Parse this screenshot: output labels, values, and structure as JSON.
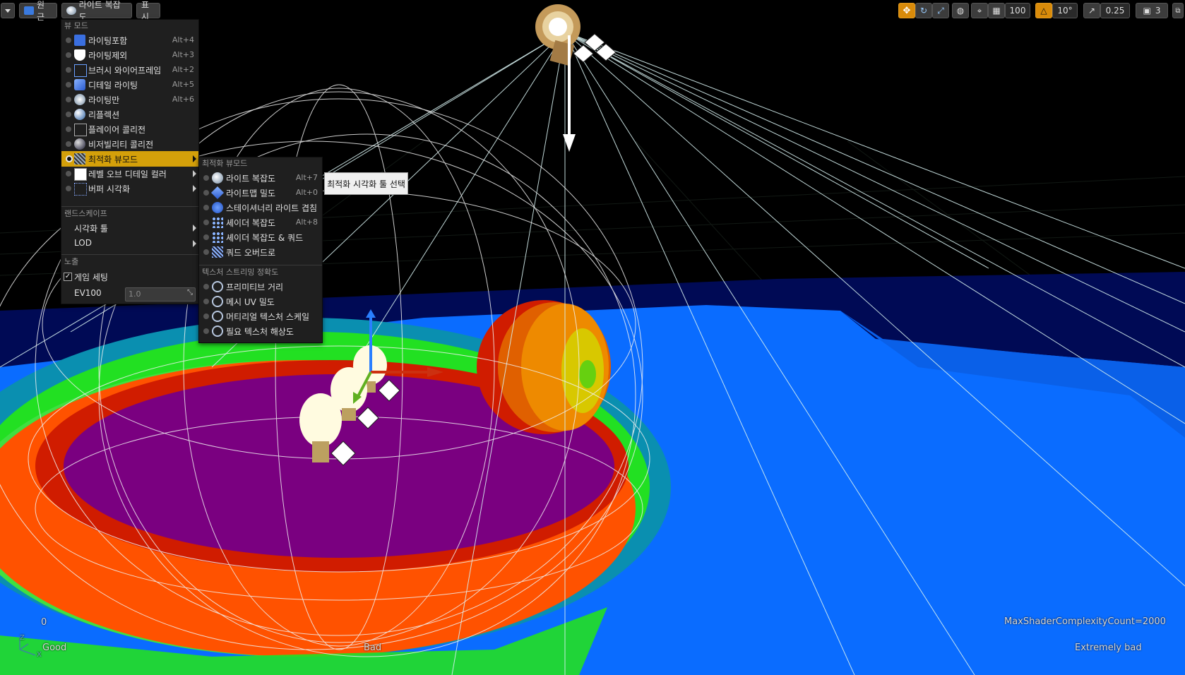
{
  "toolbar": {
    "dropdown_label": "",
    "perspective_label": "원근",
    "viewmode_label": "라이트 복잡도",
    "show_label": "표시"
  },
  "right_toolbar": {
    "grid_snap_value": "100",
    "rotation_snap_value": "10°",
    "scale_snap_value": "0.25",
    "camera_speed_value": "3"
  },
  "view_mode_menu": {
    "section_view_mode": "뷰 모드",
    "items": [
      {
        "label": "라이팅포함",
        "shortcut": "Alt+4",
        "icon": "lit-cube-icon"
      },
      {
        "label": "라이팅제외",
        "shortcut": "Alt+3",
        "icon": "unlit-shield-icon"
      },
      {
        "label": "브러시 와이어프레임",
        "shortcut": "Alt+2",
        "icon": "wireframe-cube-icon"
      },
      {
        "label": "디테일 라이팅",
        "shortcut": "Alt+5",
        "icon": "detail-lighting-icon"
      },
      {
        "label": "라이팅만",
        "shortcut": "Alt+6",
        "icon": "lighting-only-icon"
      },
      {
        "label": "리플렉션",
        "shortcut": "",
        "icon": "reflection-sphere-icon"
      },
      {
        "label": "플레이어 콜리전",
        "shortcut": "",
        "icon": "player-collision-icon"
      },
      {
        "label": "비저빌리티 콜리전",
        "shortcut": "",
        "icon": "visibility-collision-icon"
      },
      {
        "label": "최적화 뷰모드",
        "shortcut": "",
        "icon": "optimization-grid-icon",
        "selected": true,
        "submenu": true
      },
      {
        "label": "레벨 오브 디테일 컬러",
        "shortcut": "",
        "icon": "lod-color-icon",
        "submenu": true
      },
      {
        "label": "버퍼 시각화",
        "shortcut": "",
        "icon": "buffer-visualization-icon",
        "submenu": true
      }
    ],
    "section_landscape": "랜드스케이프",
    "landscape_items": [
      {
        "label": "시각화 툴"
      },
      {
        "label": "LOD"
      }
    ],
    "section_exposure": "노출",
    "game_settings_label": "게임 세팅",
    "game_settings_checked": true,
    "ev100_label": "EV100",
    "ev100_value": "1.0"
  },
  "optimization_submenu": {
    "section_optimization": "최적화 뷰모드",
    "items": [
      {
        "label": "라이트 복잡도",
        "shortcut": "Alt+7",
        "icon": "light-complexity-icon"
      },
      {
        "label": "라이트맵 밀도",
        "shortcut": "Alt+0",
        "icon": "lightmap-density-icon"
      },
      {
        "label": "스테이셔너리 라이트 겹침",
        "shortcut": "",
        "icon": "stationary-light-overlap-icon"
      },
      {
        "label": "셰이더 복잡도",
        "shortcut": "Alt+8",
        "icon": "shader-complexity-icon"
      },
      {
        "label": "셰이더 복잡도 & 쿼드",
        "shortcut": "",
        "icon": "shader-quad-icon"
      },
      {
        "label": "쿼드 오버드로",
        "shortcut": "",
        "icon": "quad-overdraw-icon"
      }
    ],
    "section_texture": "텍스처 스트리밍 정확도",
    "texture_items": [
      {
        "label": "프리미티브 거리",
        "icon": "crosshair-icon"
      },
      {
        "label": "메시 UV 밀도",
        "icon": "crosshair-icon"
      },
      {
        "label": "머티리얼 텍스처 스케일",
        "icon": "crosshair-icon"
      },
      {
        "label": "필요 텍스처 해상도",
        "icon": "crosshair-icon"
      }
    ]
  },
  "tooltip": {
    "text": "최적화 시각화 툴 선택"
  },
  "viewport": {
    "max_complexity_text": "MaxShaderComplexityCount=2000",
    "scale_zero": "0",
    "good_label": "Good",
    "bad_label": "Bad",
    "extremely_bad_label": "Extremely bad",
    "axis_z": "Z",
    "axis_x": "X"
  },
  "colors": {
    "menu_bg": "#1f1f1f",
    "selected_item": "#d4a00a",
    "floor_blue": "#0a6cff",
    "purple": "#7a0080",
    "red": "#d42000",
    "orange": "#ff5a00",
    "green": "#20e020"
  }
}
